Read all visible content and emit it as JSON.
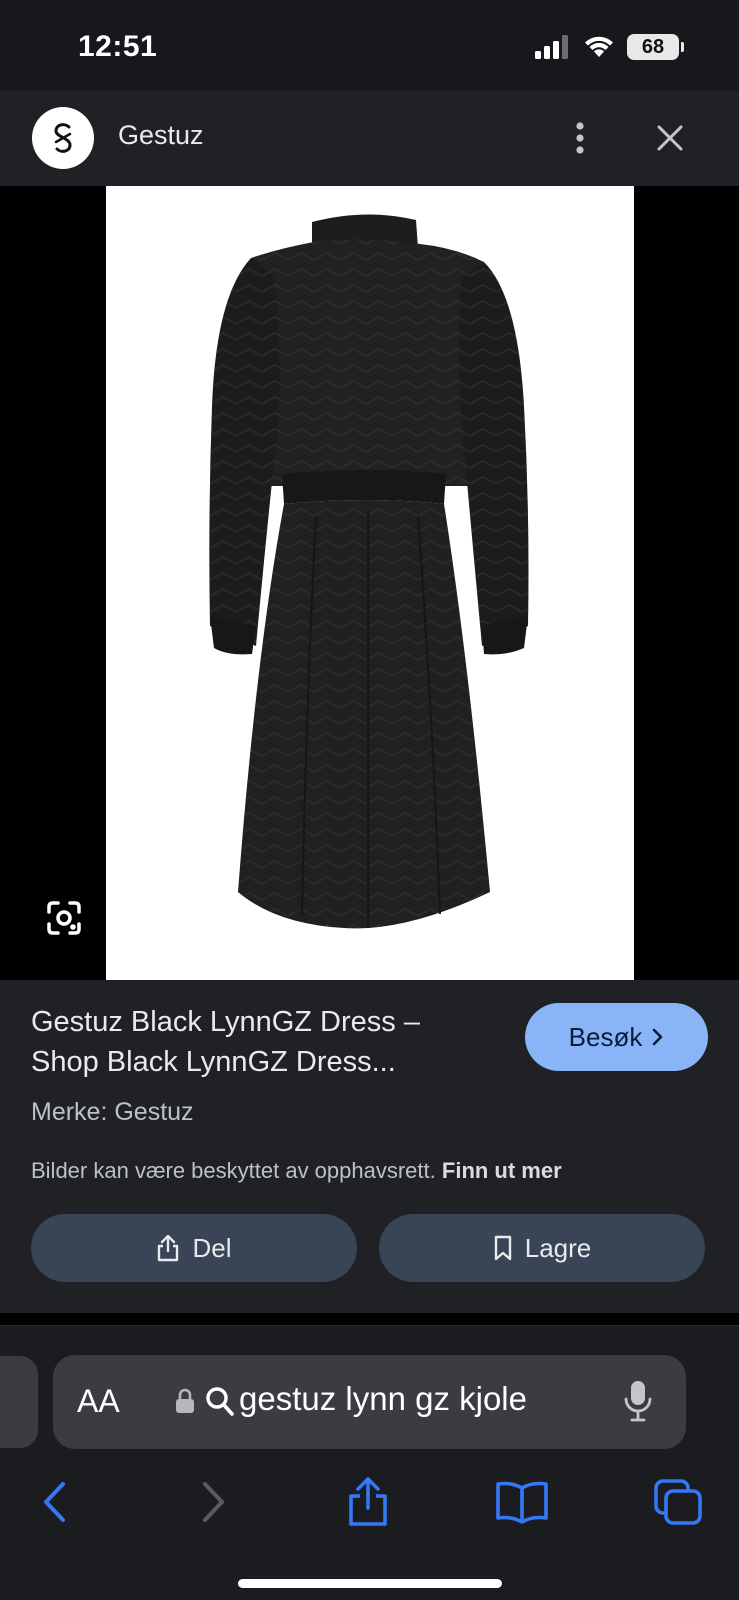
{
  "status_bar": {
    "time": "12:51",
    "battery": "68"
  },
  "source": {
    "name": "Gestuz"
  },
  "product": {
    "title_line1": "Gestuz Black LynnGZ Dress –",
    "title_line2": "Shop Black LynnGZ Dress...",
    "brand": "Merke: Gestuz",
    "copyright_text": "Bilder kan være beskyttet av opphavsrett.",
    "copyright_link": "Finn ut mer"
  },
  "buttons": {
    "visit": "Besøk",
    "share": "Del",
    "save": "Lagre"
  },
  "browser": {
    "text_size": "AA",
    "address": "gestuz lynn gz kjole"
  },
  "colors": {
    "accent": "#8ab4f8",
    "ios_blue": "#3478f6",
    "panel": "#1f2125",
    "pill": "#394457"
  },
  "icons": [
    "signal-icon",
    "wifi-icon",
    "battery-icon",
    "more-vert-icon",
    "close-icon",
    "google-lens-icon",
    "chevron-right-icon",
    "share-icon",
    "bookmark-icon",
    "lock-icon",
    "search-icon",
    "mic-icon",
    "back-icon",
    "forward-icon",
    "safari-share-icon",
    "bookmarks-icon",
    "tabs-icon"
  ]
}
